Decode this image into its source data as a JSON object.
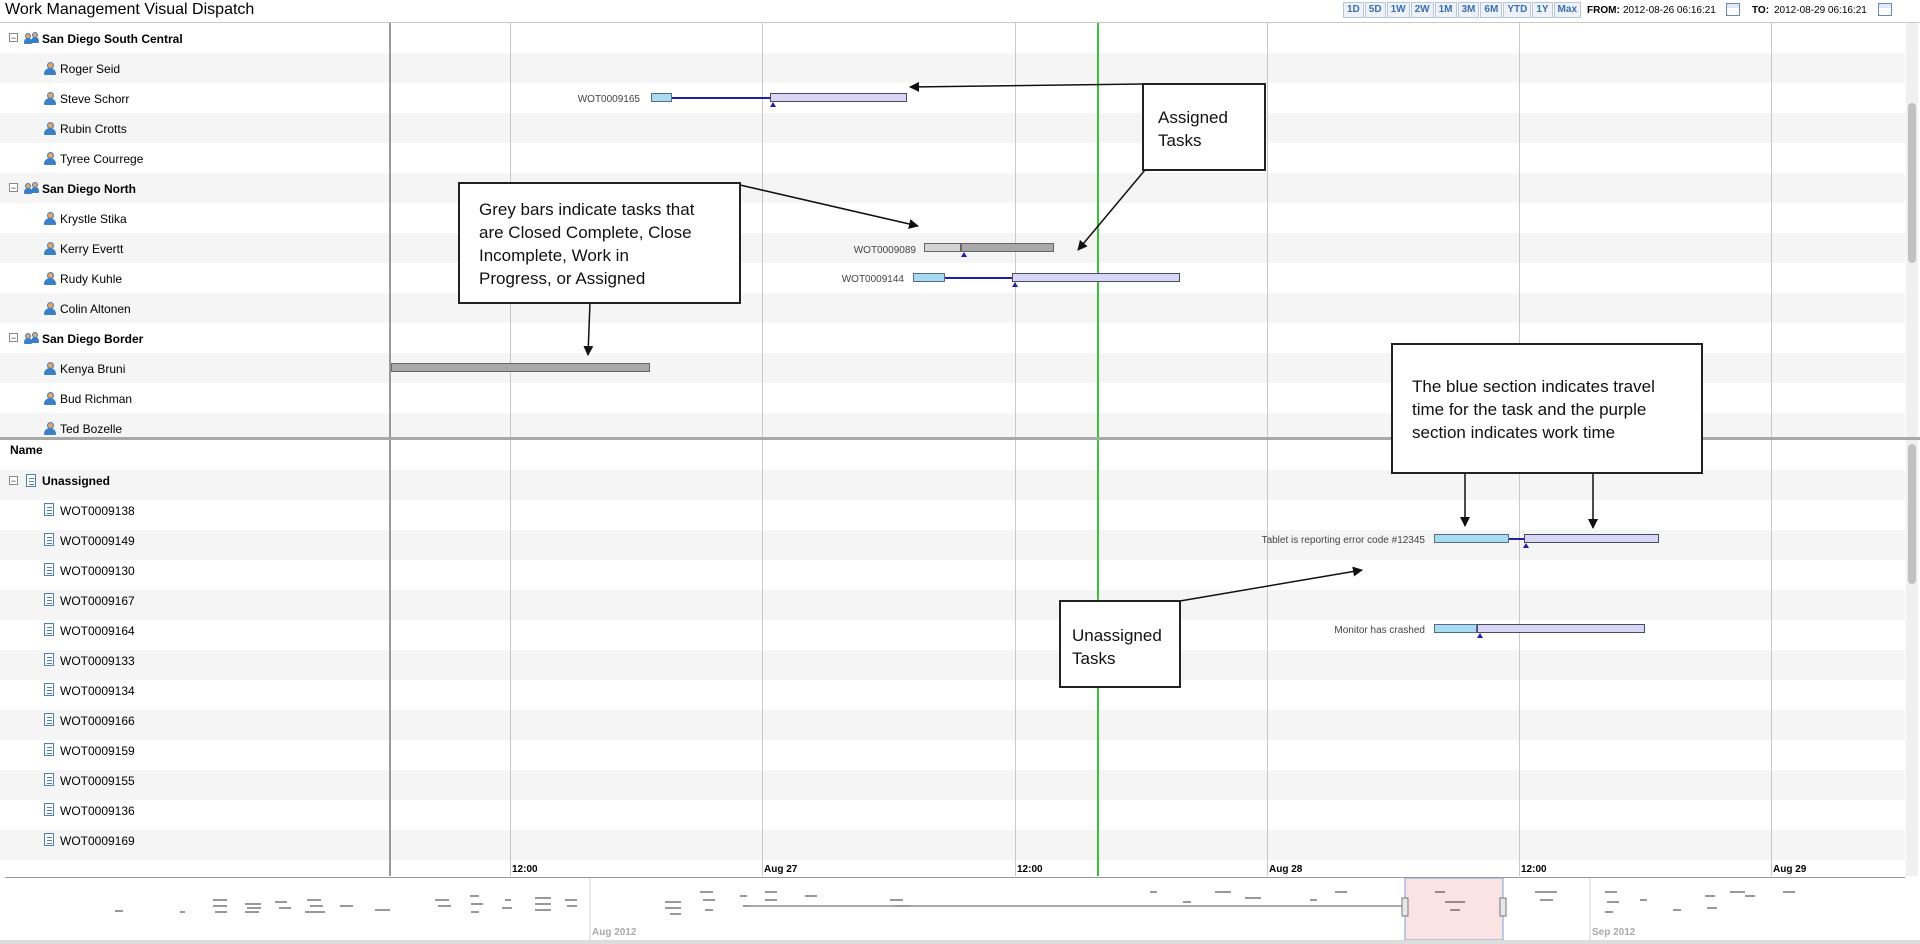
{
  "app": {
    "title": "Work Management Visual Dispatch"
  },
  "toolbar": {
    "range_buttons": [
      "1D",
      "5D",
      "1W",
      "2W",
      "1M",
      "3M",
      "6M",
      "YTD",
      "1Y",
      "Max"
    ],
    "from_label": "FROM:",
    "from_value": "2012-08-26 06:16:21",
    "to_label": "TO:",
    "to_value": "2012-08-29 06:16:21"
  },
  "assigned": {
    "groups": [
      {
        "name": "San Diego South Central",
        "members": [
          "Roger Seid",
          "Steve Schorr",
          "Rubin Crotts",
          "Tyree Courrege"
        ]
      },
      {
        "name": "San Diego North",
        "members": [
          "Krystle Stika",
          "Kerry Evertt",
          "Rudy Kuhle",
          "Colin Altonen"
        ]
      },
      {
        "name": "San Diego Border",
        "members": [
          "Kenya Bruni",
          "Bud Richman",
          "Ted Bozelle"
        ]
      }
    ],
    "tasks": {
      "steve": "WOT0009165",
      "kerry": "WOT0009089",
      "rudy": "WOT0009144"
    }
  },
  "unassigned": {
    "column_header": "Name",
    "group": "Unassigned",
    "items": [
      "WOT0009138",
      "WOT0009149",
      "WOT0009130",
      "WOT0009167",
      "WOT0009164",
      "WOT0009133",
      "WOT0009134",
      "WOT0009166",
      "WOT0009159",
      "WOT0009155",
      "WOT0009136",
      "WOT0009169"
    ],
    "task_labels": {
      "wot149": "Tablet is reporting error code #12345",
      "wot164": "Monitor has crashed"
    }
  },
  "timeline": {
    "axis_labels": [
      "12:00",
      "Aug 27",
      "12:00",
      "Aug 28",
      "12:00",
      "Aug 29"
    ]
  },
  "navigator": {
    "labels": [
      "Aug 2012",
      "Sep 2012"
    ]
  },
  "callouts": {
    "assigned": "Assigned\nTasks",
    "grey": "Grey bars indicate tasks that\nare Closed Complete, Close\nIncomplete, Work in\nProgress, or Assigned",
    "blue": "The blue section indicates travel\ntime for the task and the purple\nsection indicates work time",
    "unassigned": "Unassigned\nTasks"
  },
  "colors": {
    "travel": "#a8dcf3",
    "work": "#d9d6f5",
    "closed": "#a9a9a9",
    "now": "#3cc13c",
    "link": "#1f1fa8"
  }
}
